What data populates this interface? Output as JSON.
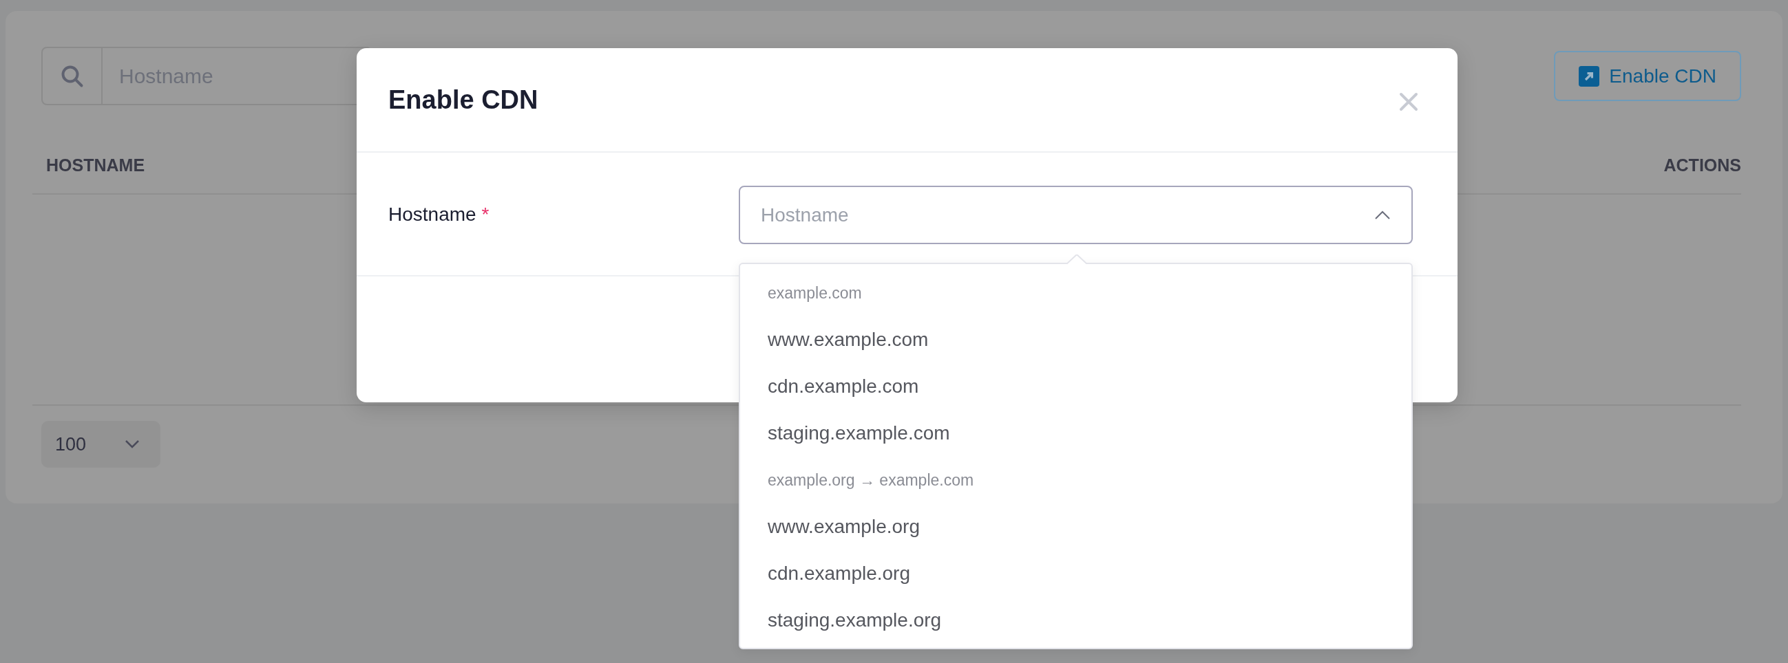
{
  "search": {
    "placeholder": "Hostname"
  },
  "action_button": {
    "label": "Enable CDN"
  },
  "table": {
    "columns": [
      "HOSTNAME",
      "ACTIONS"
    ]
  },
  "page_size": {
    "value": "100"
  },
  "modal": {
    "title": "Enable CDN",
    "field": {
      "label": "Hostname",
      "required_mark": "*",
      "placeholder": "Hostname",
      "expanded": true
    },
    "options": [
      {
        "kind": "group",
        "label": "example.com"
      },
      {
        "kind": "option",
        "label": "www.example.com",
        "selected": false
      },
      {
        "kind": "option",
        "label": "cdn.example.com",
        "selected": false
      },
      {
        "kind": "option",
        "label": "staging.example.com",
        "selected": false
      },
      {
        "kind": "group",
        "label": "example.org → example.com"
      },
      {
        "kind": "option",
        "label": "www.example.org",
        "selected": false
      },
      {
        "kind": "option",
        "label": "cdn.example.org",
        "selected": false
      },
      {
        "kind": "option",
        "label": "staging.example.org",
        "selected": false
      }
    ]
  }
}
